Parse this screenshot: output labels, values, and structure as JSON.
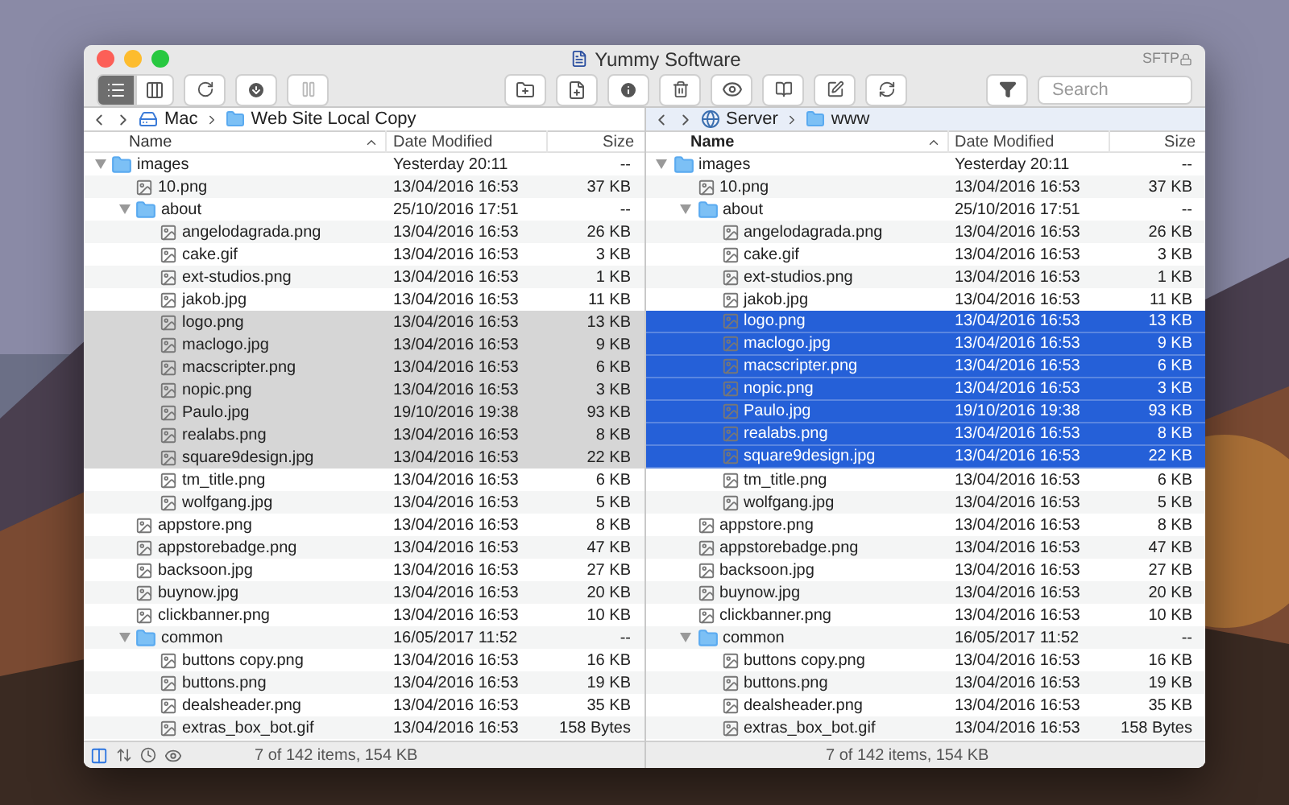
{
  "window": {
    "title": "Yummy Software",
    "protocol": "SFTP"
  },
  "toolbar": {
    "view_modes": [
      {
        "kind": "list",
        "selected": true
      },
      {
        "kind": "columns",
        "selected": false
      }
    ],
    "search": {
      "placeholder": "Search"
    }
  },
  "panes": [
    {
      "active": false,
      "show_tools": true,
      "path": [
        {
          "kind": "disk",
          "label": "Mac"
        },
        {
          "kind": "folder",
          "label": "Web Site Local Copy"
        }
      ],
      "columns": [
        "Name",
        "Date Modified",
        "Size"
      ],
      "status": "7 of 142 items, 154 KB",
      "rows": [
        {
          "kind": "folder",
          "name": "images",
          "date": "Yesterday 20:11",
          "size": "--",
          "selected": false,
          "expanded": true,
          "children": [
            {
              "kind": "file",
              "name": "10.png",
              "date": "13/04/2016 16:53",
              "size": "37 KB",
              "selected": false
            },
            {
              "kind": "folder",
              "name": "about",
              "date": "25/10/2016 17:51",
              "size": "--",
              "selected": false,
              "expanded": true,
              "children": [
                {
                  "kind": "file",
                  "name": "angelodagrada.png",
                  "date": "13/04/2016 16:53",
                  "size": "26 KB",
                  "selected": false
                },
                {
                  "kind": "file",
                  "name": "cake.gif",
                  "date": "13/04/2016 16:53",
                  "size": "3 KB",
                  "selected": false
                },
                {
                  "kind": "file",
                  "name": "ext-studios.png",
                  "date": "13/04/2016 16:53",
                  "size": "1 KB",
                  "selected": false
                },
                {
                  "kind": "file",
                  "name": "jakob.jpg",
                  "date": "13/04/2016 16:53",
                  "size": "11 KB",
                  "selected": false
                },
                {
                  "kind": "file",
                  "name": "logo.png",
                  "date": "13/04/2016 16:53",
                  "size": "13 KB",
                  "selected": true
                },
                {
                  "kind": "file",
                  "name": "maclogo.jpg",
                  "date": "13/04/2016 16:53",
                  "size": "9 KB",
                  "selected": true
                },
                {
                  "kind": "file",
                  "name": "macscripter.png",
                  "date": "13/04/2016 16:53",
                  "size": "6 KB",
                  "selected": true
                },
                {
                  "kind": "file",
                  "name": "nopic.png",
                  "date": "13/04/2016 16:53",
                  "size": "3 KB",
                  "selected": true
                },
                {
                  "kind": "file",
                  "name": "Paulo.jpg",
                  "date": "19/10/2016 19:38",
                  "size": "93 KB",
                  "selected": true
                },
                {
                  "kind": "file",
                  "name": "realabs.png",
                  "date": "13/04/2016 16:53",
                  "size": "8 KB",
                  "selected": true
                },
                {
                  "kind": "file",
                  "name": "square9design.jpg",
                  "date": "13/04/2016 16:53",
                  "size": "22 KB",
                  "selected": true
                },
                {
                  "kind": "file",
                  "name": "tm_title.png",
                  "date": "13/04/2016 16:53",
                  "size": "6 KB",
                  "selected": false
                },
                {
                  "kind": "file",
                  "name": "wolfgang.jpg",
                  "date": "13/04/2016 16:53",
                  "size": "5 KB",
                  "selected": false
                }
              ]
            },
            {
              "kind": "file",
              "name": "appstore.png",
              "date": "13/04/2016 16:53",
              "size": "8 KB",
              "selected": false
            },
            {
              "kind": "file",
              "name": "appstorebadge.png",
              "date": "13/04/2016 16:53",
              "size": "47 KB",
              "selected": false
            },
            {
              "kind": "file",
              "name": "backsoon.jpg",
              "date": "13/04/2016 16:53",
              "size": "27 KB",
              "selected": false
            },
            {
              "kind": "file",
              "name": "buynow.jpg",
              "date": "13/04/2016 16:53",
              "size": "20 KB",
              "selected": false
            },
            {
              "kind": "file",
              "name": "clickbanner.png",
              "date": "13/04/2016 16:53",
              "size": "10 KB",
              "selected": false
            },
            {
              "kind": "folder",
              "name": "common",
              "date": "16/05/2017 11:52",
              "size": "--",
              "selected": false,
              "expanded": true,
              "children": [
                {
                  "kind": "file",
                  "name": "buttons copy.png",
                  "date": "13/04/2016 16:53",
                  "size": "16 KB",
                  "selected": false
                },
                {
                  "kind": "file",
                  "name": "buttons.png",
                  "date": "13/04/2016 16:53",
                  "size": "19 KB",
                  "selected": false
                },
                {
                  "kind": "file",
                  "name": "dealsheader.png",
                  "date": "13/04/2016 16:53",
                  "size": "35 KB",
                  "selected": false
                },
                {
                  "kind": "file",
                  "name": "extras_box_bot.gif",
                  "date": "13/04/2016 16:53",
                  "size": "158 Bytes",
                  "selected": false
                }
              ]
            }
          ]
        }
      ]
    },
    {
      "active": true,
      "show_tools": false,
      "path": [
        {
          "kind": "server",
          "label": "Server"
        },
        {
          "kind": "folder",
          "label": "www"
        }
      ],
      "columns": [
        "Name",
        "Date Modified",
        "Size"
      ],
      "status": "7 of 142 items, 154 KB",
      "rows": [
        {
          "kind": "folder",
          "name": "images",
          "date": "Yesterday 20:11",
          "size": "--",
          "selected": false,
          "expanded": true,
          "children": [
            {
              "kind": "file",
              "name": "10.png",
              "date": "13/04/2016 16:53",
              "size": "37 KB",
              "selected": false
            },
            {
              "kind": "folder",
              "name": "about",
              "date": "25/10/2016 17:51",
              "size": "--",
              "selected": false,
              "expanded": true,
              "children": [
                {
                  "kind": "file",
                  "name": "angelodagrada.png",
                  "date": "13/04/2016 16:53",
                  "size": "26 KB",
                  "selected": false
                },
                {
                  "kind": "file",
                  "name": "cake.gif",
                  "date": "13/04/2016 16:53",
                  "size": "3 KB",
                  "selected": false
                },
                {
                  "kind": "file",
                  "name": "ext-studios.png",
                  "date": "13/04/2016 16:53",
                  "size": "1 KB",
                  "selected": false
                },
                {
                  "kind": "file",
                  "name": "jakob.jpg",
                  "date": "13/04/2016 16:53",
                  "size": "11 KB",
                  "selected": false
                },
                {
                  "kind": "file",
                  "name": "logo.png",
                  "date": "13/04/2016 16:53",
                  "size": "13 KB",
                  "selected": true
                },
                {
                  "kind": "file",
                  "name": "maclogo.jpg",
                  "date": "13/04/2016 16:53",
                  "size": "9 KB",
                  "selected": true
                },
                {
                  "kind": "file",
                  "name": "macscripter.png",
                  "date": "13/04/2016 16:53",
                  "size": "6 KB",
                  "selected": true
                },
                {
                  "kind": "file",
                  "name": "nopic.png",
                  "date": "13/04/2016 16:53",
                  "size": "3 KB",
                  "selected": true
                },
                {
                  "kind": "file",
                  "name": "Paulo.jpg",
                  "date": "19/10/2016 19:38",
                  "size": "93 KB",
                  "selected": true
                },
                {
                  "kind": "file",
                  "name": "realabs.png",
                  "date": "13/04/2016 16:53",
                  "size": "8 KB",
                  "selected": true
                },
                {
                  "kind": "file",
                  "name": "square9design.jpg",
                  "date": "13/04/2016 16:53",
                  "size": "22 KB",
                  "selected": true
                },
                {
                  "kind": "file",
                  "name": "tm_title.png",
                  "date": "13/04/2016 16:53",
                  "size": "6 KB",
                  "selected": false
                },
                {
                  "kind": "file",
                  "name": "wolfgang.jpg",
                  "date": "13/04/2016 16:53",
                  "size": "5 KB",
                  "selected": false
                }
              ]
            },
            {
              "kind": "file",
              "name": "appstore.png",
              "date": "13/04/2016 16:53",
              "size": "8 KB",
              "selected": false
            },
            {
              "kind": "file",
              "name": "appstorebadge.png",
              "date": "13/04/2016 16:53",
              "size": "47 KB",
              "selected": false
            },
            {
              "kind": "file",
              "name": "backsoon.jpg",
              "date": "13/04/2016 16:53",
              "size": "27 KB",
              "selected": false
            },
            {
              "kind": "file",
              "name": "buynow.jpg",
              "date": "13/04/2016 16:53",
              "size": "20 KB",
              "selected": false
            },
            {
              "kind": "file",
              "name": "clickbanner.png",
              "date": "13/04/2016 16:53",
              "size": "10 KB",
              "selected": false
            },
            {
              "kind": "folder",
              "name": "common",
              "date": "16/05/2017 11:52",
              "size": "--",
              "selected": false,
              "expanded": true,
              "children": [
                {
                  "kind": "file",
                  "name": "buttons copy.png",
                  "date": "13/04/2016 16:53",
                  "size": "16 KB",
                  "selected": false
                },
                {
                  "kind": "file",
                  "name": "buttons.png",
                  "date": "13/04/2016 16:53",
                  "size": "19 KB",
                  "selected": false
                },
                {
                  "kind": "file",
                  "name": "dealsheader.png",
                  "date": "13/04/2016 16:53",
                  "size": "35 KB",
                  "selected": false
                },
                {
                  "kind": "file",
                  "name": "extras_box_bot.gif",
                  "date": "13/04/2016 16:53",
                  "size": "158 Bytes",
                  "selected": false
                }
              ]
            }
          ]
        }
      ]
    }
  ]
}
